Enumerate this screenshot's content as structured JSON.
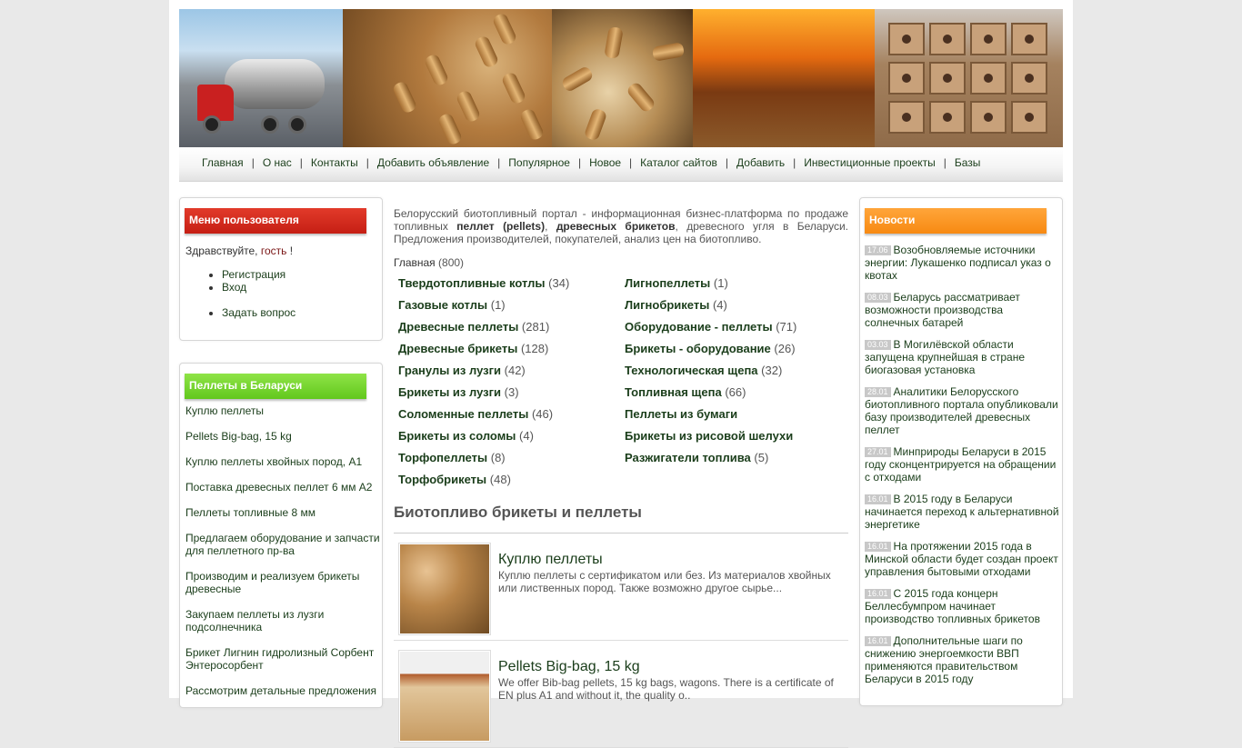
{
  "nav": {
    "items": [
      "Главная",
      "О нас",
      "Контакты",
      "Добавить объявление",
      "Популярное",
      "Новое",
      "Каталог сайтов",
      "Добавить",
      "Инвестиционные проекты",
      "Базы"
    ],
    "separator": "|"
  },
  "user_menu": {
    "title": "Меню пользователя",
    "greeting": "Здравствуйте,",
    "guest": "гость",
    "exclaim": "!",
    "items": [
      "Регистрация",
      "Вход"
    ],
    "ask": "Задать вопрос"
  },
  "pellets_box": {
    "title": "Пеллеты в Беларуси",
    "items": [
      "Куплю пеллеты",
      "Pellets Big-bag, 15 kg",
      "Куплю пеллеты хвойных пород, А1",
      "Поставка древесных пеллет 6 мм А2",
      "Пеллеты топливные 8 мм",
      "Предлагаем оборудование и запчасти для пеллетного пр-ва",
      "Производим и реализуем брикеты древесные",
      "Закупаем пеллеты из лузги подсолнечника",
      "Брикет Лигнин гидролизный Сорбент Энтеросорбент",
      "Рассмотрим детальные предложения"
    ]
  },
  "intro": {
    "part1": "Белорусский биотопливный портал - информационная бизнес-платформа по продаже топливных ",
    "bold1": "пеллет (pellets)",
    "comma": ", ",
    "bold2": "древесных брикетов",
    "part2": ", древесного угля в Беларуси. Предложения производителей, покупателей, анализ цен на биотопливо."
  },
  "breadcrumb": {
    "label": "Главная",
    "count": "(800)"
  },
  "categories": [
    {
      "name": "Твердотопливные котлы",
      "count": "(34)"
    },
    {
      "name": "Лигнопеллеты",
      "count": "(1)"
    },
    {
      "name": "Газовые котлы",
      "count": "(1)"
    },
    {
      "name": "Лигнобрикеты",
      "count": "(4)"
    },
    {
      "name": "Древесные пеллеты",
      "count": "(281)"
    },
    {
      "name": "Оборудование - пеллеты",
      "count": "(71)"
    },
    {
      "name": "Древесные брикеты",
      "count": "(128)"
    },
    {
      "name": "Брикеты - оборудование",
      "count": "(26)"
    },
    {
      "name": "Гранулы из лузги",
      "count": "(42)"
    },
    {
      "name": "Технологическая щепа",
      "count": "(32)"
    },
    {
      "name": "Брикеты из лузги",
      "count": "(3)"
    },
    {
      "name": "Топливная щепа",
      "count": "(66)"
    },
    {
      "name": "Соломенные пеллеты",
      "count": "(46)"
    },
    {
      "name": "Пеллеты из бумаги",
      "count": ""
    },
    {
      "name": "Брикеты из соломы",
      "count": "(4)"
    },
    {
      "name": "Брикеты из рисовой шелухи",
      "count": ""
    },
    {
      "name": "Торфопеллеты",
      "count": "(8)"
    },
    {
      "name": "Разжигатели топлива",
      "count": "(5)"
    },
    {
      "name": "Торфобрикеты",
      "count": "(48)"
    }
  ],
  "section_title": "Биотопливо брикеты и пеллеты",
  "ads": [
    {
      "title": "Куплю пеллеты",
      "desc": "Куплю пеллеты с сертификатом или без. Из материалов хвойных или лиственных пород. Также возможно другое сырье..."
    },
    {
      "title": "Pellets Big-bag, 15 kg",
      "desc": "We offer Bib-bag pellets, 15 kg bags, wagons. There is a certificate of EN plus A1 and without it, the quality o.."
    }
  ],
  "news": {
    "title": "Новости",
    "items": [
      {
        "date": "17.06",
        "text": "Возобновляемые источники энергии: Лукашенко подписал указ о квотах"
      },
      {
        "date": "08.03",
        "text": "Беларусь рассматривает возможности производства солнечных батарей"
      },
      {
        "date": "03.03",
        "text": "В Могилёвской области запущена крупнейшая в стране биогазовая установка"
      },
      {
        "date": "28.01",
        "text": "Аналитики Белорусского биотопливного портала опубликовали базу производителей древесных пеллет"
      },
      {
        "date": "27.01",
        "text": "Минприроды Беларуси в 2015 году сконцентрируется на обращении с отходами"
      },
      {
        "date": "16.01",
        "text": "В 2015 году в Беларуси начинается переход к альтернативной энергетике"
      },
      {
        "date": "16.01",
        "text": "На протяжении 2015 года в Минской области будет создан проект управления бытовыми отходами"
      },
      {
        "date": "16.01",
        "text": "С 2015 года концерн Беллесбумпром начинает производство топливных брикетов"
      },
      {
        "date": "16.01",
        "text": "Дополнительные шаги по снижению энергоемкости ВВП применяются правительством Беларуси в 2015 году"
      }
    ]
  },
  "colors": {
    "user_header": "#d52a1e",
    "pellets_header": "#6fd22a",
    "news_header": "#f7921f",
    "link": "#1a3d1a"
  },
  "icons": [
    "truck-image",
    "pellets-image",
    "fire-image",
    "briquettes-image"
  ]
}
